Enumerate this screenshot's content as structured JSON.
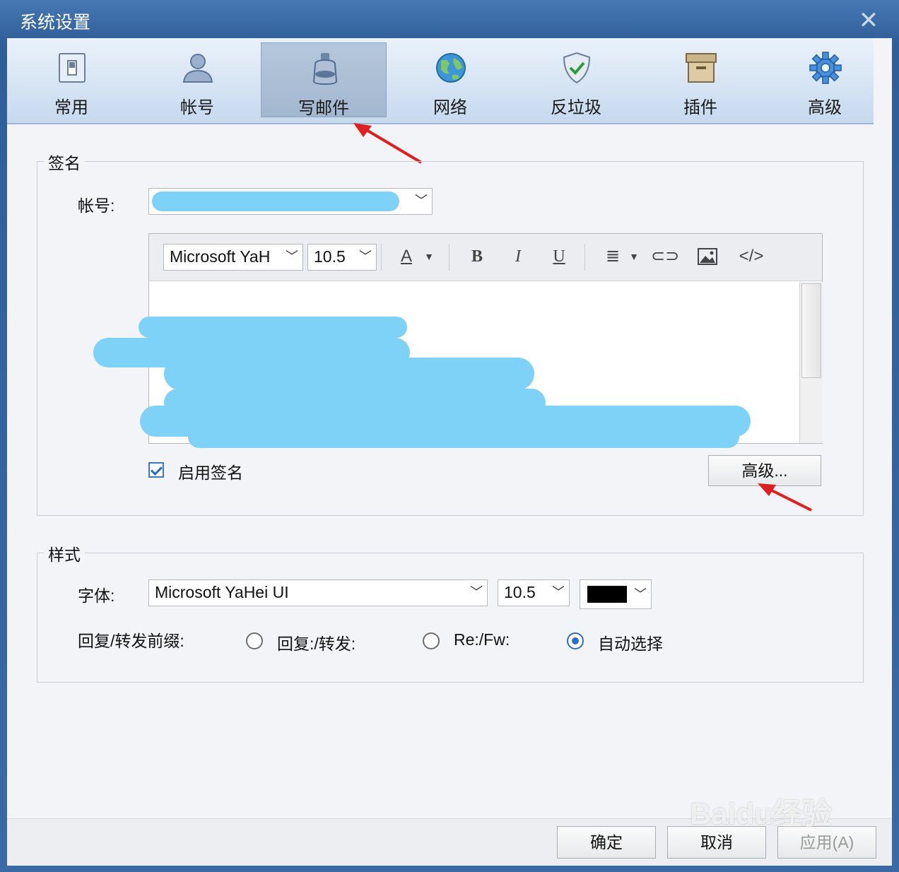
{
  "window": {
    "title": "系统设置"
  },
  "tabs": [
    {
      "label": "常用",
      "icon": "switch-icon"
    },
    {
      "label": "帐号",
      "icon": "user-icon"
    },
    {
      "label": "写邮件",
      "icon": "inkpot-icon",
      "active": true
    },
    {
      "label": "网络",
      "icon": "globe-icon"
    },
    {
      "label": "反垃圾",
      "icon": "shield-icon"
    },
    {
      "label": "插件",
      "icon": "box-icon"
    },
    {
      "label": "高级",
      "icon": "gear-icon"
    }
  ],
  "signature": {
    "group_label": "签名",
    "account_label": "帐号:",
    "font_value": "Microsoft YaH",
    "size_value": "10.5",
    "enable_label": "启用签名",
    "enabled": true,
    "advanced_button": "高级..."
  },
  "style": {
    "group_label": "样式",
    "font_label": "字体:",
    "font_value": "Microsoft YaHei UI",
    "size_value": "10.5",
    "color_value": "#000000",
    "prefix_label": "回复/转发前缀:",
    "options": [
      "回复:/转发:",
      "Re:/Fw:",
      "自动选择"
    ],
    "selected": "自动选择"
  },
  "footer": {
    "ok": "确定",
    "cancel": "取消",
    "apply": "应用(A)"
  },
  "watermark": "Baidu经验"
}
